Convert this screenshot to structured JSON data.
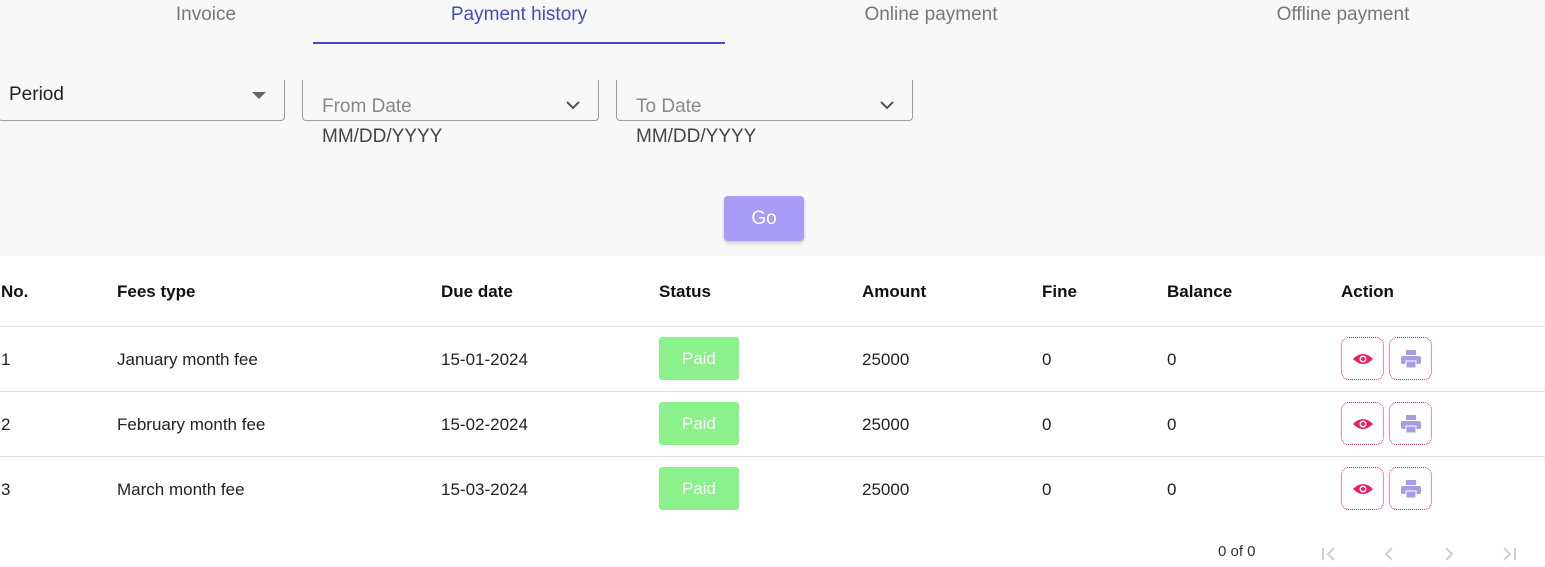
{
  "tabs": [
    {
      "label": "Invoice"
    },
    {
      "label": "Payment history"
    },
    {
      "label": "Online payment"
    },
    {
      "label": "Offline payment"
    }
  ],
  "filters": {
    "period": {
      "value": "Period"
    },
    "from_date": {
      "label": "From Date",
      "hint": "MM/DD/YYYY"
    },
    "to_date": {
      "label": "To Date",
      "hint": "MM/DD/YYYY"
    },
    "go_label": "Go"
  },
  "table": {
    "headers": [
      "No.",
      "Fees type",
      "Due date",
      "Status",
      "Amount",
      "Fine",
      "Balance",
      "Action"
    ],
    "rows": [
      {
        "no": "1",
        "fees_type": "January month fee",
        "due_date": "15-01-2024",
        "status": "Paid",
        "amount": "25000",
        "fine": "0",
        "balance": "0"
      },
      {
        "no": "2",
        "fees_type": "February month fee",
        "due_date": "15-02-2024",
        "status": "Paid",
        "amount": "25000",
        "fine": "0",
        "balance": "0"
      },
      {
        "no": "3",
        "fees_type": "March month fee",
        "due_date": "15-03-2024",
        "status": "Paid",
        "amount": "25000",
        "fine": "0",
        "balance": "0"
      }
    ],
    "action_icons": [
      "eye-icon",
      "printer-icon"
    ]
  },
  "pagination": {
    "text": "0 of 0"
  },
  "colors": {
    "accent": "#3f51b5",
    "go_button": "#a89cf7",
    "paid_badge": "#8cf08c",
    "view_icon": "#e91e63",
    "print_icon": "#a99be6"
  }
}
